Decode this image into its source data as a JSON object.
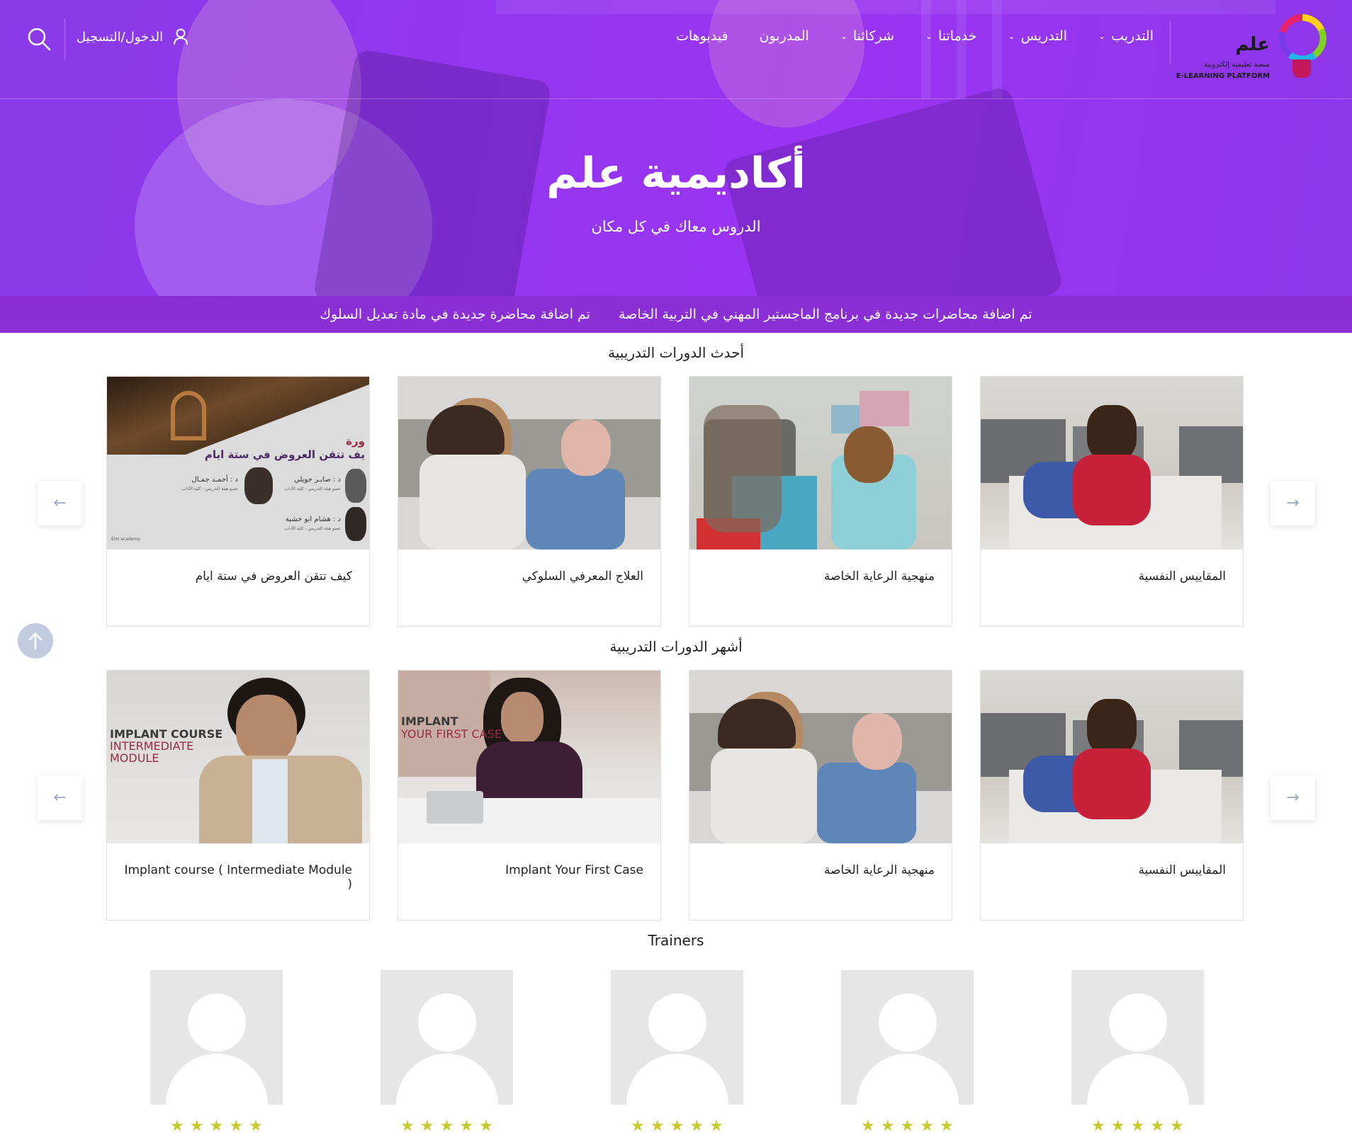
{
  "brand": {
    "logo_word": "علم",
    "logo_subtitle": "منصة تعليمية إلكترونية",
    "logo_english": "E-LEARNING PLATFORM"
  },
  "nav": {
    "items": [
      {
        "label": "التدريب",
        "has_dropdown": true
      },
      {
        "label": "التدريس",
        "has_dropdown": true
      },
      {
        "label": "خدماتنا",
        "has_dropdown": true
      },
      {
        "label": "شركائنا",
        "has_dropdown": true
      },
      {
        "label": "المدربون",
        "has_dropdown": false
      },
      {
        "label": "فيديوهات",
        "has_dropdown": false
      }
    ],
    "login_label": "الدخول/التسجيل",
    "icons": {
      "user": "user-icon",
      "search": "search-icon",
      "chevron": "chevron-down-icon"
    }
  },
  "hero": {
    "title": "أكاديمية علم",
    "subtitle": "الدروس معاك في كل مكان"
  },
  "ticker": {
    "items": [
      "تم اضافة محاضرات جديدة في برنامج الماجستير المهني في التربية الخاصة",
      "تم اضافة محاضرة جديدة في مادة تعديل السلوك"
    ]
  },
  "latest": {
    "title": "أحدث الدورات التدريبية",
    "cards": [
      {
        "title": "المقاييس النفسية"
      },
      {
        "title": "منهجية الرعاية الخاصة"
      },
      {
        "title": "العلاج المعرفي السلوكي"
      },
      {
        "title": "كيف تتقن العروض في ستة ايام"
      }
    ],
    "thumb4_text": {
      "heading": "ورة",
      "headline": "يف تتقن العروض في ستة ايام",
      "name1": "د : صابـر جويلي",
      "name2": "د : أحمـد جمـال",
      "name3": "د : هشام ابو خشبة",
      "role": "عضو هيئة التدريس - كلية الآداب",
      "footer": "Elm academy"
    }
  },
  "popular": {
    "title": "أشهر الدورات التدريبية",
    "cards": [
      {
        "title": "المقاييس النفسية"
      },
      {
        "title": "منهجية الرعاية الخاصة"
      },
      {
        "title": "Implant Your First Case"
      },
      {
        "title": "Implant course ( Intermediate Module )"
      }
    ],
    "thumb3_text": {
      "line1": "IMPLANT",
      "line2": "YOUR FIRST CASE"
    },
    "thumb4_text": {
      "line1": "IMPLANT COURSE",
      "line2": "INTERMEDIATE",
      "line3": "MODULE"
    }
  },
  "trainers": {
    "title": "Trainers",
    "count": 5,
    "rating": 5,
    "star_glyph": "★"
  },
  "colors": {
    "hero_purple": "#9336ef",
    "ticker_purple": "#8a2fd6",
    "star_yellow": "#c6ca2e",
    "arrow_blue": "#9aa4c8"
  }
}
